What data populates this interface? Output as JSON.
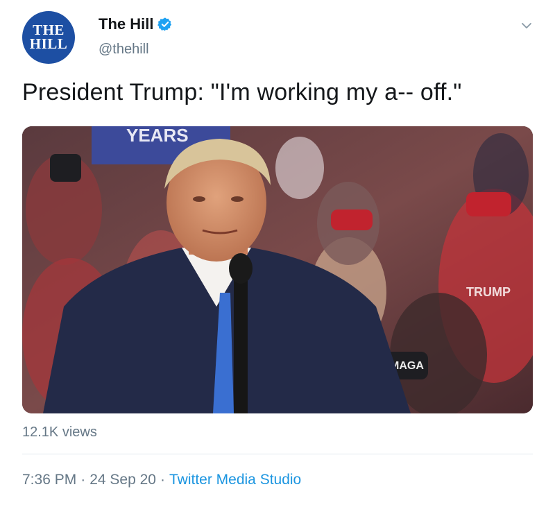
{
  "author": {
    "avatar_text_line1": "THE",
    "avatar_text_line2": "HILL",
    "display_name": "The Hill",
    "handle": "@thehill",
    "verified": true,
    "avatar_color": "#1d4fa3"
  },
  "tweet": {
    "text": "President Trump: \"I'm working my a-- off.\"",
    "views": "12.1K views",
    "time": "7:36 PM",
    "date": "24 Sep 20",
    "separator": "·",
    "source": "Twitter Media Studio"
  },
  "media": {
    "type": "video-still",
    "sign_text": "YEARS",
    "mask_text": "MAGA",
    "shirt_text": "TRUMP"
  },
  "icons": {
    "verified": "verified-badge-icon",
    "menu": "chevron-down-icon"
  },
  "colors": {
    "link": "#1b95e0",
    "secondary_text": "#657786",
    "verified_badge": "#1da1f2"
  }
}
